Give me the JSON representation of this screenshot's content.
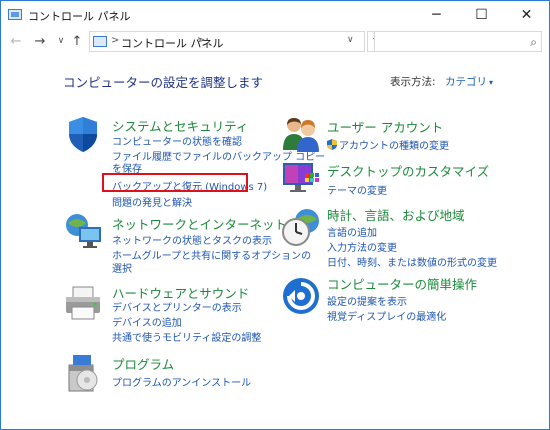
{
  "window": {
    "title": "コントロール パネル"
  },
  "titlebar": {
    "minimize_glyph": "─",
    "maximize_glyph": "☐",
    "close_glyph": "✕"
  },
  "address": {
    "back_glyph": "←",
    "forward_glyph": "→",
    "recent_glyph": "∨",
    "up_glyph": "↑",
    "separator": ">",
    "crumb": "コントロール パネル",
    "dropdown_glyph": "∨",
    "refresh_glyph": "↻",
    "search_placeholder": "",
    "search_glyph": "⌕"
  },
  "main": {
    "heading": "コンピューターの設定を調整します",
    "view_by_label": "表示方法:",
    "view_by_value": "カテゴリ",
    "view_by_caret": "▾"
  },
  "categories": [
    {
      "title": "システムとセキュリティ",
      "icon": "shield-icon",
      "links": [
        "コンピューターの状態を確認",
        "ファイル履歴でファイルのバックアップ コピー",
        "を保存",
        "バックアップと復元 (Windows 7)",
        "問題の発見と解決"
      ]
    },
    {
      "title": "ネットワークとインターネット",
      "icon": "network-globe-icon",
      "links": [
        "ネットワークの状態とタスクの表示",
        "ホームグループと共有に関するオプションの",
        "選択"
      ]
    },
    {
      "title": "ハードウェアとサウンド",
      "icon": "printer-icon",
      "links": [
        "デバイスとプリンターの表示",
        "デバイスの追加",
        "共通で使うモビリティ設定の調整"
      ]
    },
    {
      "title": "プログラム",
      "icon": "programs-icon",
      "links": [
        "プログラムのアンインストール"
      ]
    },
    {
      "title": "ユーザー アカウント",
      "icon": "users-icon",
      "links": [
        "アカウントの種類の変更"
      ]
    },
    {
      "title": "デスクトップのカスタマイズ",
      "icon": "desktop-customize-icon",
      "links": [
        "テーマの変更"
      ]
    },
    {
      "title": "時計、言語、および地域",
      "icon": "clock-globe-icon",
      "links": [
        "言語の追加",
        "入力方法の変更",
        "日付、時刻、または数値の形式の変更"
      ]
    },
    {
      "title": "コンピューターの簡単操作",
      "icon": "ease-of-access-icon",
      "links": [
        "設定の提案を表示",
        "視覚ディスプレイの最適化"
      ]
    }
  ],
  "colors": {
    "category_title": "#1b8a3a",
    "link": "#1e56b3",
    "heading": "#1e3287",
    "highlight": "#e0101b",
    "window_border": "#2b79d8"
  }
}
